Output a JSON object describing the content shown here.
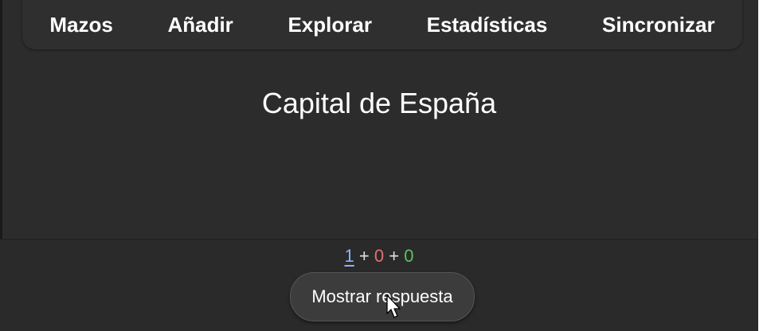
{
  "toolbar": {
    "items": [
      "Mazos",
      "Añadir",
      "Explorar",
      "Estadísticas",
      "Sincronizar"
    ]
  },
  "card": {
    "question": "Capital de España"
  },
  "counts": {
    "new": "1",
    "learning": "0",
    "review": "0",
    "separator": "+"
  },
  "answer_button": {
    "label": "Mostrar respuesta"
  },
  "colors": {
    "background": "#2c2c2c",
    "new_count": "#8ab4f8",
    "learning_count": "#e07070",
    "review_count": "#5cc25c"
  },
  "icons": {
    "cursor": "hand-pointer-icon"
  }
}
